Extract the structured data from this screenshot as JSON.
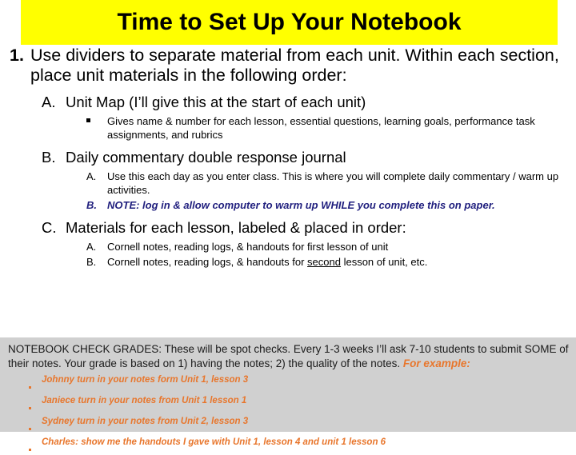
{
  "slide": {
    "title": "Time to Set Up Your Notebook",
    "title_background": "#FFFF00",
    "accent_navy": "#201F7E",
    "accent_orange": "#E8762C",
    "panel_background": "#D0D0D0"
  },
  "outline": {
    "item1": {
      "marker": "1.",
      "text": "Use dividers to separate material from each unit. Within each section, place unit materials in the following order:"
    },
    "itemA": {
      "marker": "A.",
      "text": "Unit Map (I’ll give this at the start of each unit)",
      "sub1": {
        "marker": "▪",
        "text": "Gives name & number for each lesson, essential questions, learning goals, performance task assignments, and rubrics"
      }
    },
    "itemB": {
      "marker": "B.",
      "text": "Daily commentary double response journal",
      "subA": {
        "marker": "A.",
        "text": "Use this each day as you enter class. This is where you will complete daily commentary / warm up activities."
      },
      "subB": {
        "marker": "B.",
        "text": "NOTE: log in & allow computer to warm up WHILE you complete this on paper."
      }
    },
    "itemC": {
      "marker": "C.",
      "text": "Materials for each lesson, labeled & placed in order:",
      "subA": {
        "marker": "A.",
        "text": "Cornell notes, reading logs, & handouts for first lesson of unit"
      },
      "subB": {
        "marker": "B.",
        "text_before": "Cornell notes, reading logs, & handouts for ",
        "text_underlined": "second",
        "text_after": " lesson of unit, etc."
      }
    }
  },
  "notebook_check": {
    "paragraph_main": "NOTEBOOK CHECK GRADES: These will be spot checks. Every 1-3 weeks I’ll ask 7-10 students to submit SOME of their notes. Your grade is based on 1) having the notes; 2) the quality of the notes. ",
    "paragraph_accent": "For example:",
    "examples": [
      "Johnny turn in your notes form Unit 1, lesson 3",
      "Janiece turn in your notes from Unit 1 lesson 1",
      "Sydney turn in your notes from Unit 2, lesson 3",
      "Charles: show me the handouts I gave with Unit 1, lesson 4 and unit 1 lesson 6"
    ]
  }
}
